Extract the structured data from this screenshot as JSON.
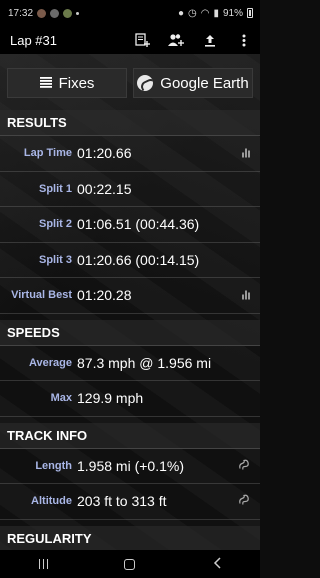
{
  "status_bar": {
    "time": "17:32",
    "battery": "91%"
  },
  "app_bar": {
    "title": "Lap #31",
    "actions": [
      {
        "name": "add-note-icon"
      },
      {
        "name": "add-person-icon"
      },
      {
        "name": "share-upload-icon"
      },
      {
        "name": "more-options-icon"
      }
    ]
  },
  "buttons": {
    "fixes_label": "Fixes",
    "google_earth_label": "Google Earth"
  },
  "sections": {
    "results": {
      "header": "RESULTS",
      "rows": [
        {
          "label": "Lap Time",
          "value": "01:20.66",
          "chart_icon": true
        },
        {
          "label": "Split 1",
          "value": "00:22.15"
        },
        {
          "label": "Split 2",
          "value": "01:06.51 (00:44.36)"
        },
        {
          "label": "Split 3",
          "value": "01:20.66 (00:14.15)"
        },
        {
          "label": "Virtual Best",
          "value": "01:20.28",
          "chart_icon": true
        }
      ]
    },
    "speeds": {
      "header": "SPEEDS",
      "rows": [
        {
          "label": "Average",
          "value": "87.3 mph @ 1.956 mi"
        },
        {
          "label": "Max",
          "value": "129.9 mph"
        }
      ]
    },
    "track_info": {
      "header": "TRACK INFO",
      "rows": [
        {
          "label": "Length",
          "value": "1.958 mi (+0.1%)"
        },
        {
          "label": "Altitude",
          "value": "203 ft to 313 ft"
        }
      ]
    },
    "regularity": {
      "header": "REGULARITY"
    }
  },
  "colors": {
    "label_blue": "#a9b6e6",
    "background": "#101010"
  }
}
